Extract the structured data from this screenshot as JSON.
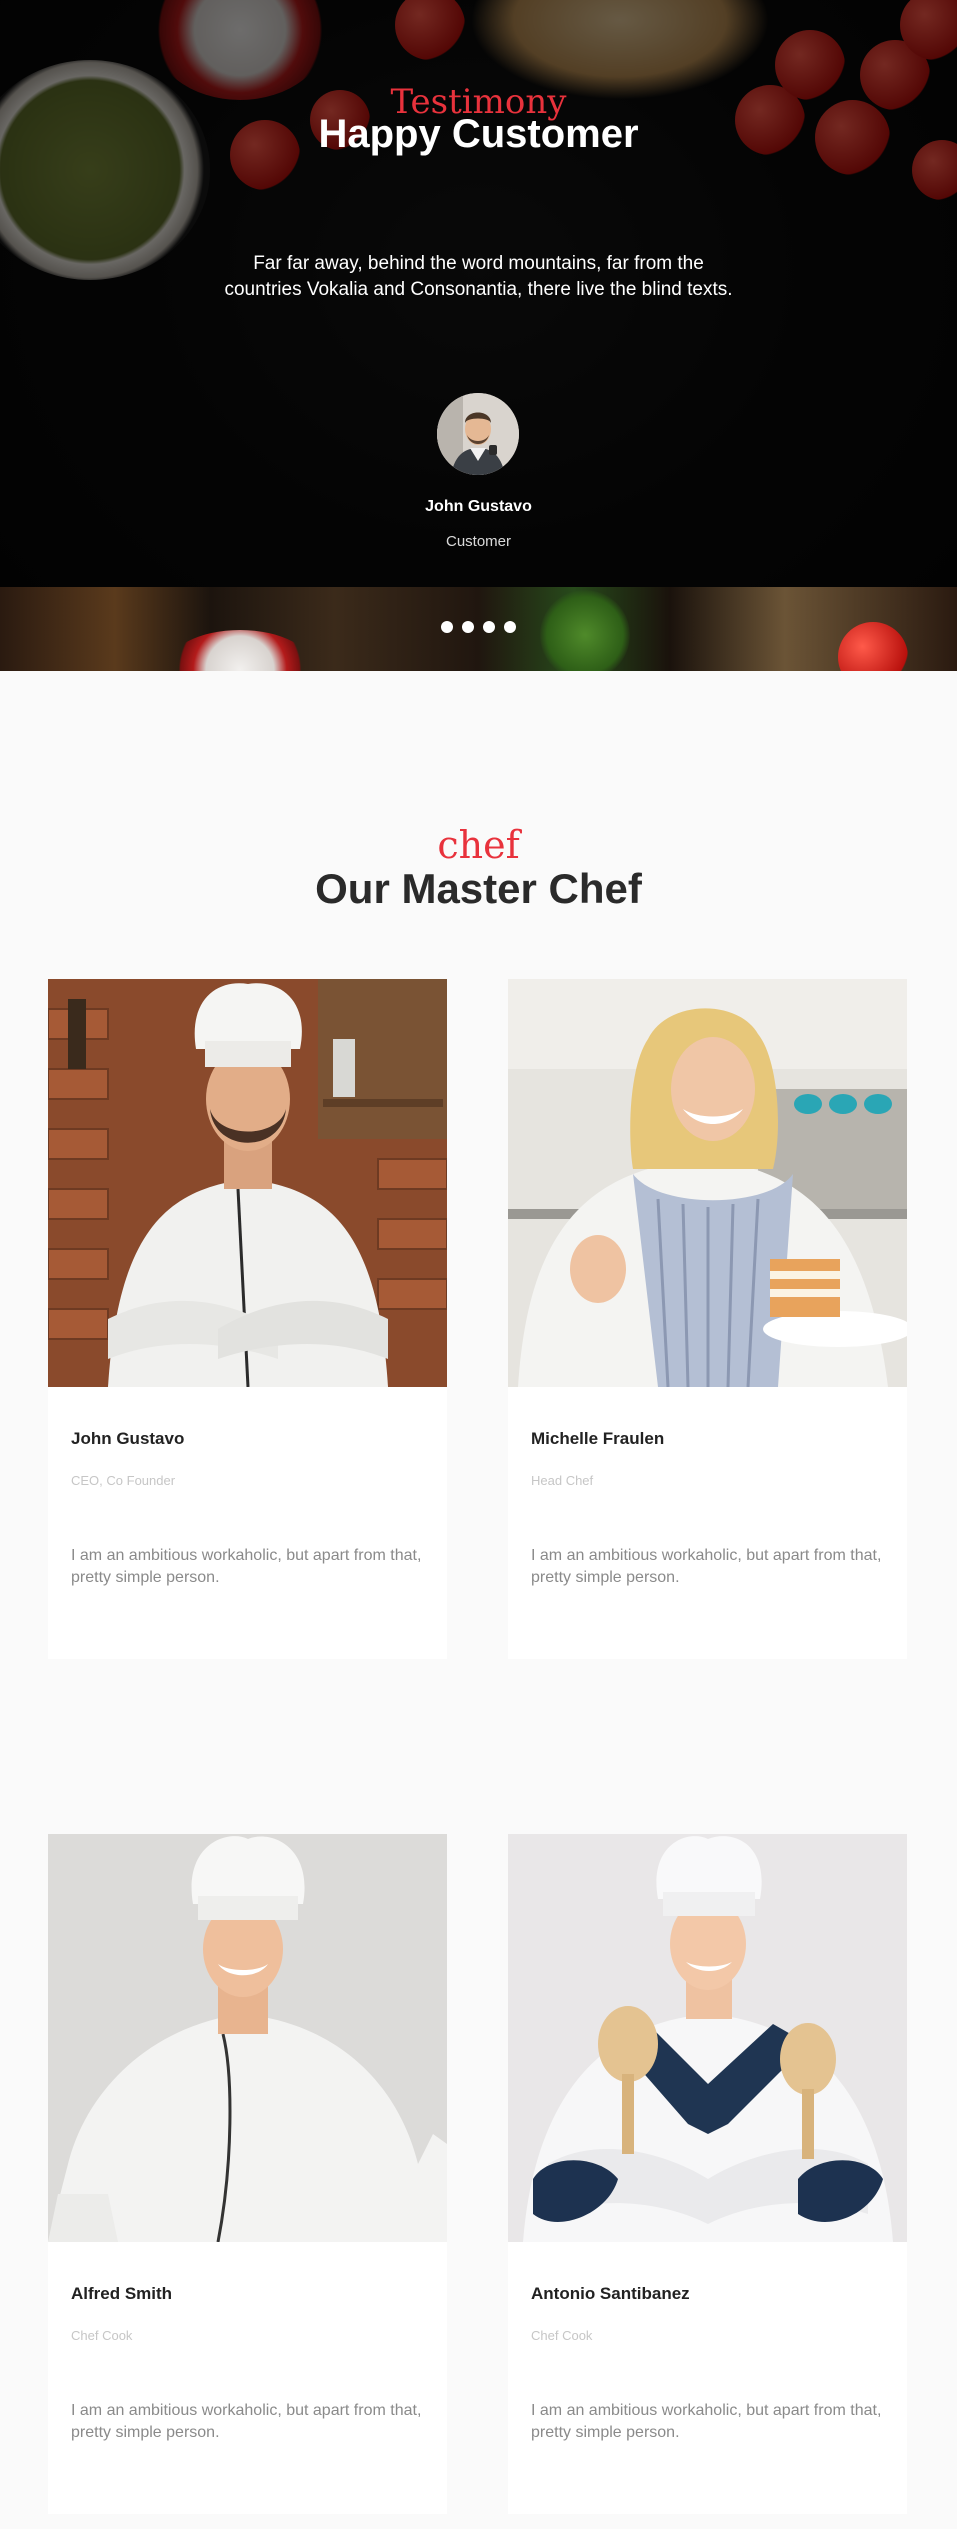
{
  "testimony": {
    "subtitle": "Testimony",
    "title": "Happy Customer",
    "quote": "Far far away, behind the word mountains, far from the countries Vokalia and Consonantia, there live the blind texts.",
    "name": "John Gustavo",
    "role": "Customer",
    "slides": 4,
    "active_slide": 1
  },
  "chefs": {
    "subtitle": "chef",
    "title": "Our Master Chef",
    "items": [
      {
        "name": "John Gustavo",
        "position": "CEO, Co Founder",
        "bio": "I am an ambitious workaholic, but apart from that, pretty simple person."
      },
      {
        "name": "Michelle Fraulen",
        "position": "Head Chef",
        "bio": "I am an ambitious workaholic, but apart from that, pretty simple person."
      },
      {
        "name": "Alfred Smith",
        "position": "Chef Cook",
        "bio": "I am an ambitious workaholic, but apart from that, pretty simple person."
      },
      {
        "name": "Antonio Santibanez",
        "position": "Chef Cook",
        "bio": "I am an ambitious workaholic, but apart from that, pretty simple person."
      }
    ]
  },
  "colors": {
    "accent": "#e8323c",
    "heading": "#2a2a2a",
    "muted": "#8a8a8a",
    "light": "#c6c6c6",
    "background": "#fafafa"
  }
}
